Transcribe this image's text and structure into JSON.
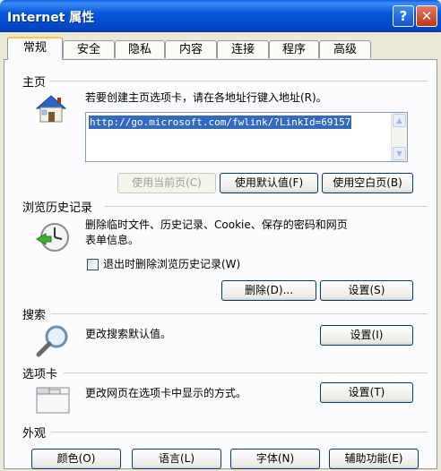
{
  "window": {
    "title": "Internet 属性",
    "help_label": "?",
    "close_label": "✕"
  },
  "tabs": [
    "常规",
    "安全",
    "隐私",
    "内容",
    "连接",
    "程序",
    "高级"
  ],
  "home": {
    "section_label": "主页",
    "instruction": "若要创建主页选项卡，请在各地址行键入地址(R)。",
    "url": "http://go.microsoft.com/fwlink/?LinkId=69157",
    "btn_current": "使用当前页(C)",
    "btn_default": "使用默认值(F)",
    "btn_blank": "使用空白页(B)"
  },
  "history": {
    "section_label": "浏览历史记录",
    "description_line1": "删除临时文件、历史记录、Cookie、保存的密码和网页",
    "description_line2": "表单信息。",
    "checkbox_label": "退出时删除浏览历史记录(W)",
    "checkbox_checked": false,
    "btn_delete": "删除(D)...",
    "btn_settings": "设置(S)"
  },
  "search": {
    "section_label": "搜索",
    "description": "更改搜索默认值。",
    "btn_settings": "设置(I)"
  },
  "tabs_section": {
    "section_label": "选项卡",
    "description": "更改网页在选项卡中显示的方式。",
    "btn_settings": "设置(T)"
  },
  "appearance": {
    "section_label": "外观",
    "btn_colors": "颜色(O)",
    "btn_languages": "语言(L)",
    "btn_fonts": "字体(N)",
    "btn_accessibility": "辅助功能(E)"
  },
  "icons": {
    "home": "house-icon",
    "history": "clock-history-icon",
    "search": "magnifier-icon",
    "tabs": "tabs-window-icon"
  },
  "colors": {
    "titlebar": "#0757dc",
    "dialog_bg": "#ece9d8",
    "panel_bg": "#fcfcfe",
    "active_tab_accent": "#ffc83c",
    "selection": "#316ac5"
  }
}
